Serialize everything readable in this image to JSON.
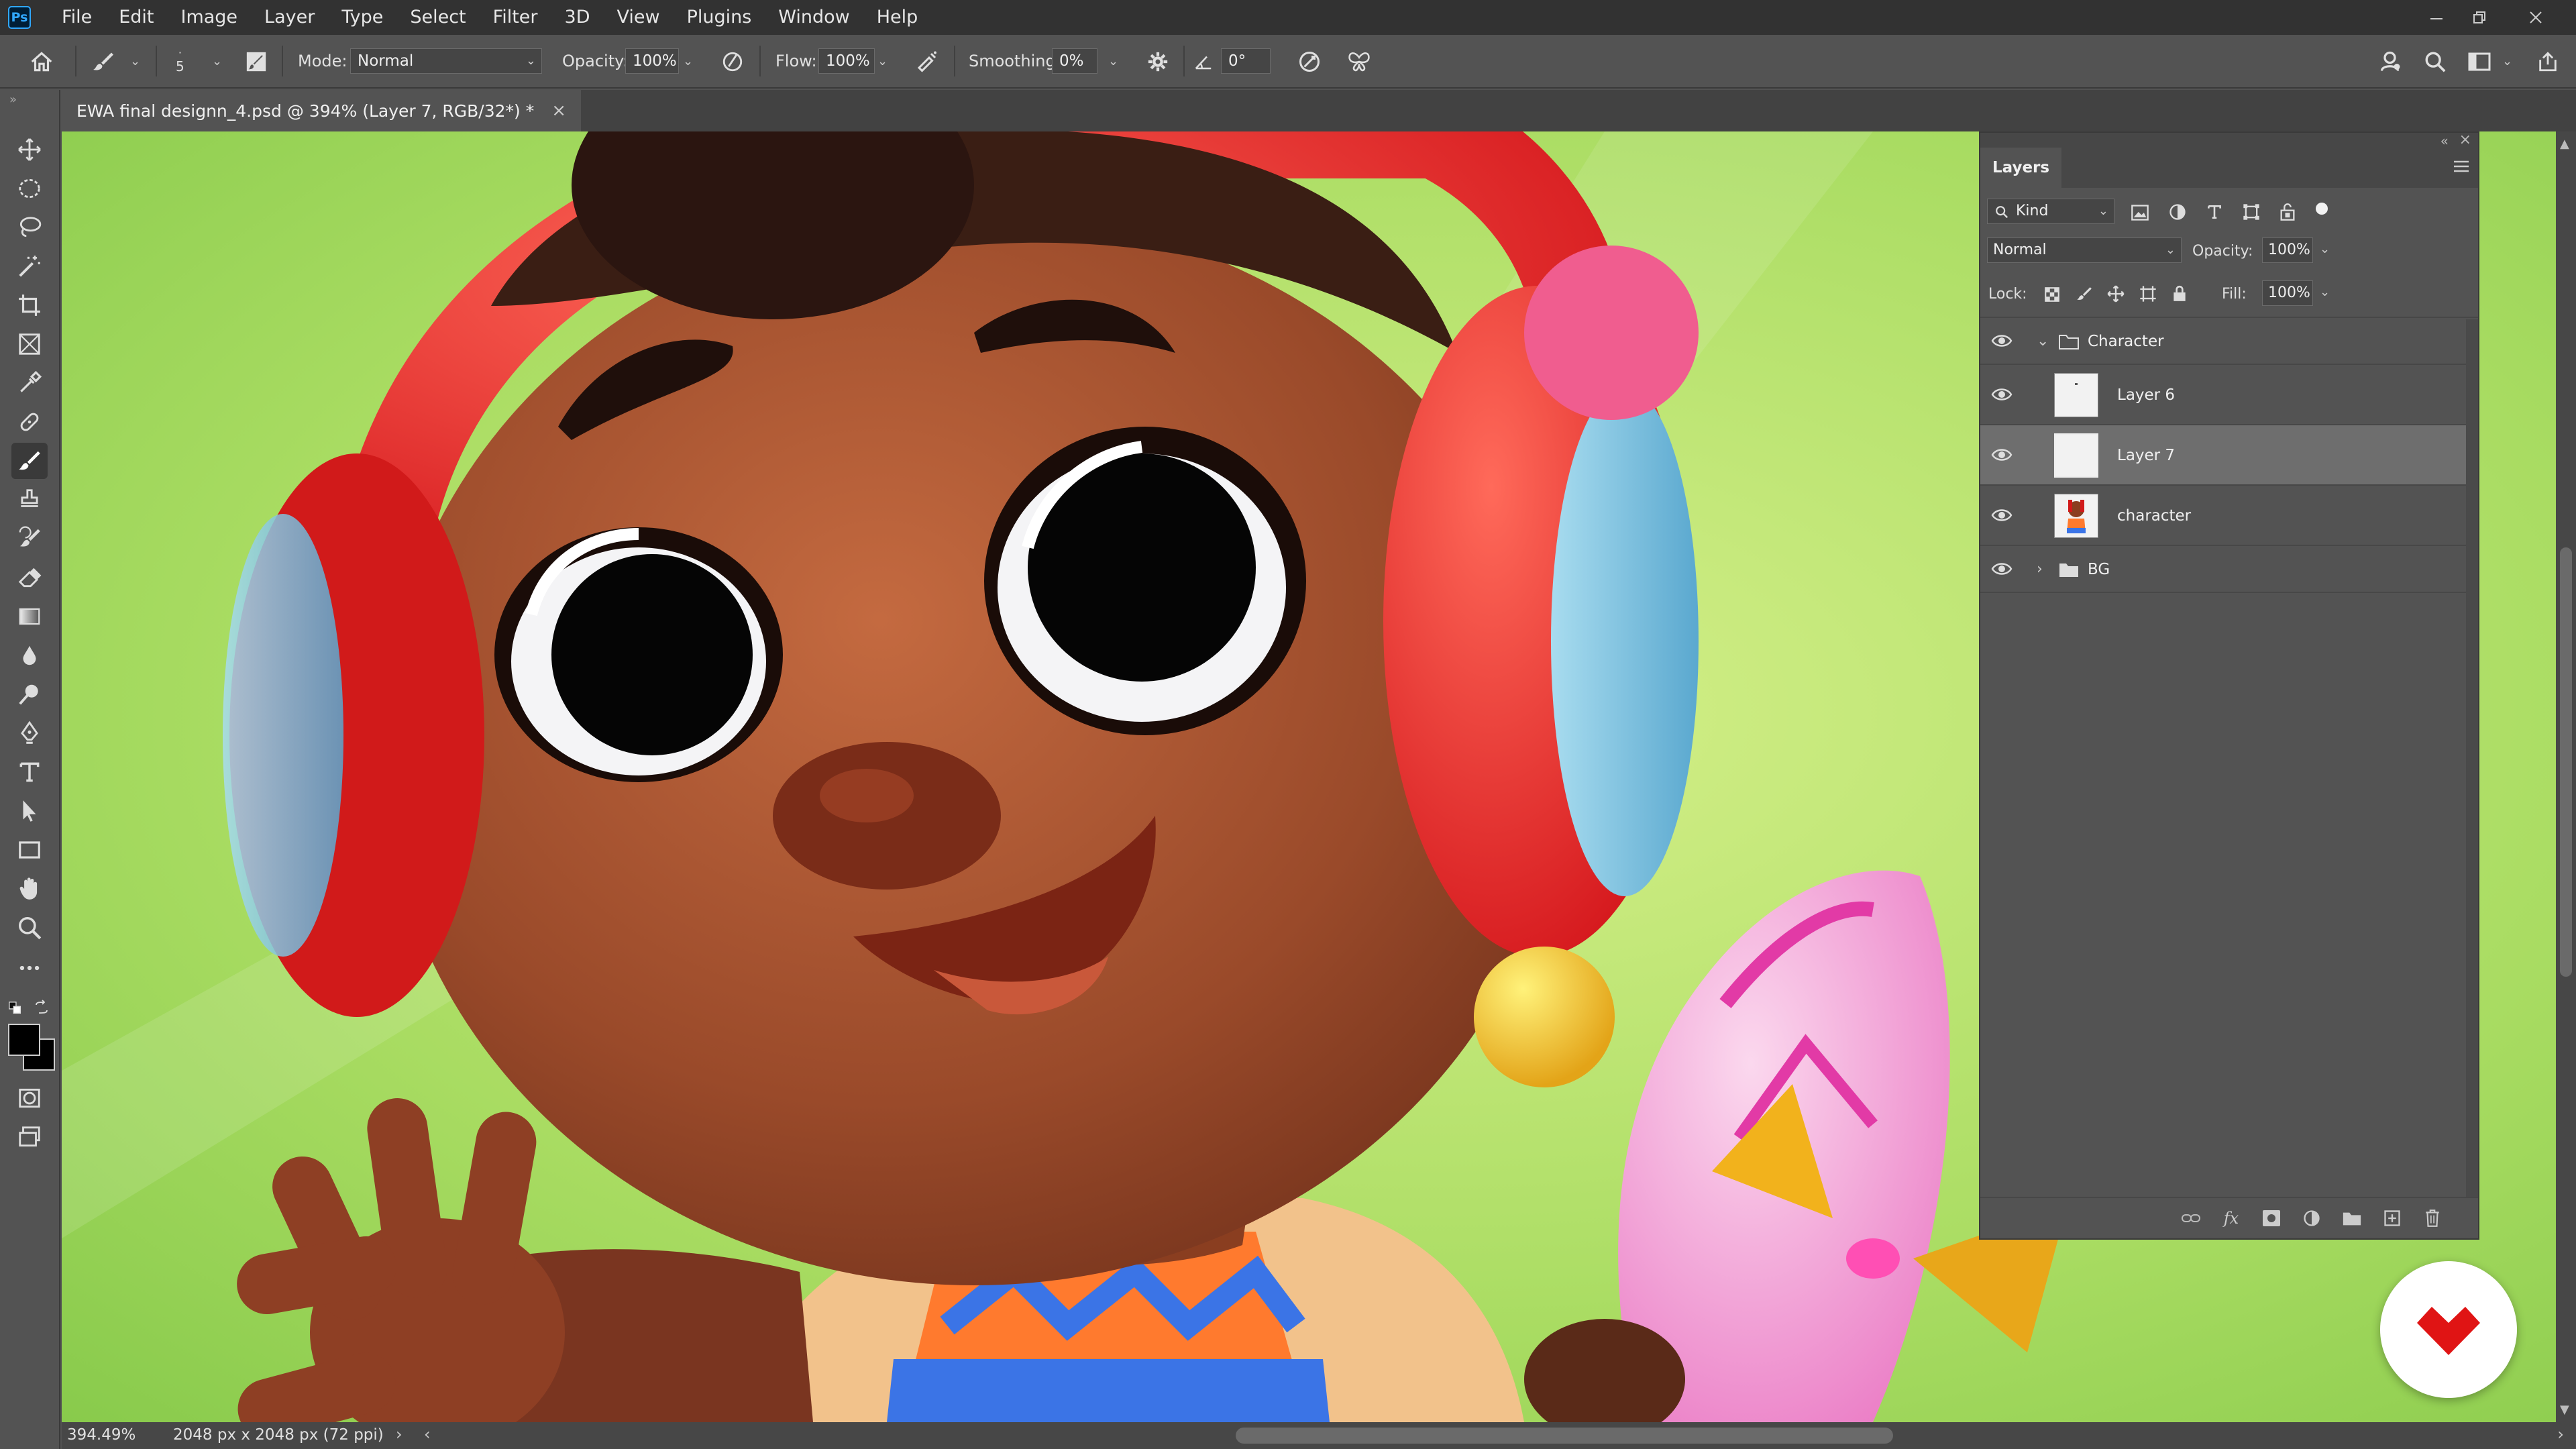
{
  "app": {
    "logo": "Ps",
    "menu": [
      "File",
      "Edit",
      "Image",
      "Layer",
      "Type",
      "Select",
      "Filter",
      "3D",
      "View",
      "Plugins",
      "Window",
      "Help"
    ]
  },
  "options": {
    "brush_size": "5",
    "mode_label": "Mode:",
    "mode_value": "Normal",
    "opacity_label": "Opacity:",
    "opacity_value": "100%",
    "flow_label": "Flow:",
    "flow_value": "100%",
    "smoothing_label": "Smoothing:",
    "smoothing_value": "0%",
    "angle_value": "0°"
  },
  "document": {
    "tab_title": "EWA final designn_4.psd @ 394% (Layer 7, RGB/32*) *"
  },
  "layers_panel": {
    "title": "Layers",
    "filter_kind": "Kind",
    "blend_mode": "Normal",
    "opacity_label": "Opacity:",
    "opacity_value": "100%",
    "lock_label": "Lock:",
    "fill_label": "Fill:",
    "fill_value": "100%",
    "layers": [
      {
        "name": "Character",
        "type": "group",
        "expanded": true
      },
      {
        "name": "Layer 6",
        "type": "layer",
        "selected": false
      },
      {
        "name": "Layer 7",
        "type": "layer",
        "selected": true
      },
      {
        "name": "character",
        "type": "layer",
        "selected": false
      },
      {
        "name": "BG",
        "type": "group",
        "expanded": false
      }
    ]
  },
  "status": {
    "zoom": "394.49%",
    "doc_info": "2048 px x 2048 px (72 ppi)"
  },
  "colors": {
    "accent": "#31a8ff",
    "panel_bg": "#535353",
    "menubar_bg": "#323232",
    "canvas_green": "#9fd75a",
    "watermark_red": "#e01414"
  }
}
